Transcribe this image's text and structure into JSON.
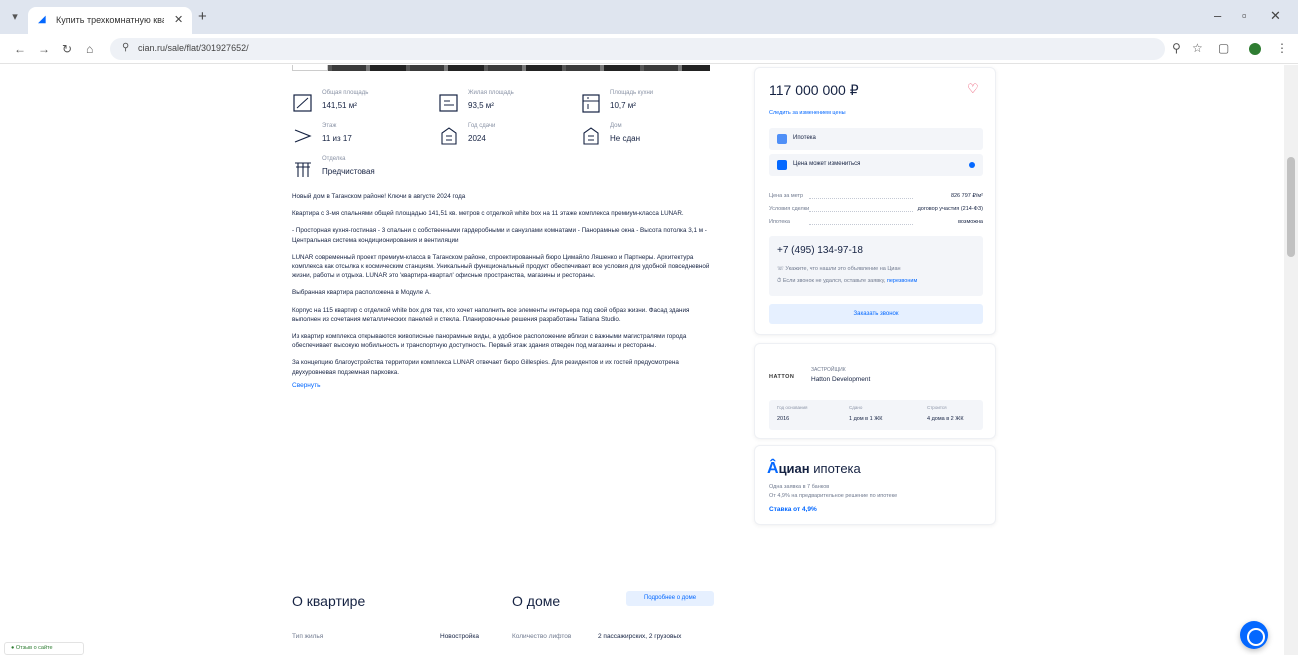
{
  "browser": {
    "tab_title": "Купить трехкомнатную квартиру",
    "tab_favicon": "cian-icon",
    "url": "cian.ru/sale/flat/301927652/"
  },
  "facts": [
    {
      "icon": "area-icon",
      "label": "Общая площадь",
      "value": "141,51 м²"
    },
    {
      "icon": "living-area-icon",
      "label": "Жилая площадь",
      "value": "93,5 м²"
    },
    {
      "icon": "kitchen-icon",
      "label": "Площадь кухни",
      "value": "10,7 м²"
    },
    {
      "icon": "floor-icon",
      "label": "Этаж",
      "value": "11 из 17"
    },
    {
      "icon": "building-icon",
      "label": "Год сдачи",
      "value": "2024"
    },
    {
      "icon": "house-icon",
      "label": "Дом",
      "value": "Не сдан"
    },
    {
      "icon": "finish-icon",
      "label": "Отделка",
      "value": "Предчистовая"
    }
  ],
  "description": {
    "paragraphs": [
      "Новый дом в Таганском районе! Ключи в августе 2024 года",
      "Квартира с 3-мя спальнями общей площадью 141,51 кв. метров с отделкой white box на 11 этаже комплекса премиум-класса LUNAR.",
      "- Просторная кухня-гостиная - 3 спальни с собственными гардеробными и санузлами комнатами - Панорамные окна - Высота потолка 3,1 м - Центральная система кондиционирования и вентиляции",
      "LUNAR современный проект премиум-класса в Таганском районе, спроектированный бюро Цимайло Ляшенко и Партнеры. Архитектура комплекса как отсылка к космическим станциям. Уникальный функциональный продукт обеспечивает все условия для удобной повседневной жизни, работы и отдыха. LUNAR это 'квартира-квартал' офисные пространства, магазины и рестораны.",
      "Выбранная квартира расположена в Модуле А.",
      "Корпус на 115 квартир с отделкой white box для тех, кто хочет наполнить все элементы интерьера под свой образ жизни. Фасад здания выполнен из сочетания металлических панелей и стекла. Планировочные решения разработаны Tatiana Studio.",
      "Из квартир комплекса открываются живописные панорамные виды, а удобное расположение вблизи с важными магистралями города обеспечивает высокую мобильность и транспортную доступность. Первый этаж здания отведен под магазины и рестораны.",
      "За концепцию благоустройства территории комплекса LUNAR отвечает бюро Gillespies. Для резидентов и их гостей предусмотрена двухуровневая подземная парковка."
    ],
    "more_link": "Свернуть"
  },
  "about_flat": {
    "title": "О квартире",
    "rows": [
      {
        "k": "Тип жилья",
        "v": "Новостройка"
      }
    ]
  },
  "about_house": {
    "title": "О доме",
    "button": "Подробнее о доме",
    "rows": [
      {
        "k": "Количество лифтов",
        "v": "2 пассажирских, 2 грузовых"
      }
    ]
  },
  "sidebar": {
    "price": "117 000 000 ₽",
    "price_link": "Следить за изменением цены",
    "mortgage_row": "Ипотека",
    "comments_row": "Цена может измениться",
    "kv": [
      {
        "k": "Цена за метр",
        "v": "826 797 ₽/м²"
      },
      {
        "k": "Условия сделки",
        "v": "договор участия (214-ФЗ)"
      },
      {
        "k": "Ипотека",
        "v": "возможна"
      }
    ],
    "phone": "+7 (495) 134-97-18",
    "phone_note_1": "Укажите, что нашли это объявление на Циан",
    "phone_note_2": "Если звонок не удался, оставьте заявку,",
    "phone_note_link": "перезвоним",
    "call_button": "Заказать звонок",
    "developer": {
      "logo": "HATTON",
      "kicker": "ЗАСТРОЙЩИК",
      "name": "Hatton Development",
      "stats": [
        {
          "k": "Год основания",
          "v": "2016"
        },
        {
          "k": "Сдано",
          "v": "1 дом в 1 ЖК"
        },
        {
          "k": "Строится",
          "v": "4 дома в 2 ЖК"
        }
      ]
    },
    "ipoteka": {
      "brand": "циан",
      "word": "ипотека",
      "line1": "Одна заявка в 7 банков",
      "line2": "От 4,9% на предварительное решение по ипотеке",
      "rate": "Ставка от 4,9%"
    }
  },
  "feedback": "Отзыв о сайте",
  "colors": {
    "accent": "#0468ff",
    "text": "#152242",
    "heart": "#e84260"
  }
}
